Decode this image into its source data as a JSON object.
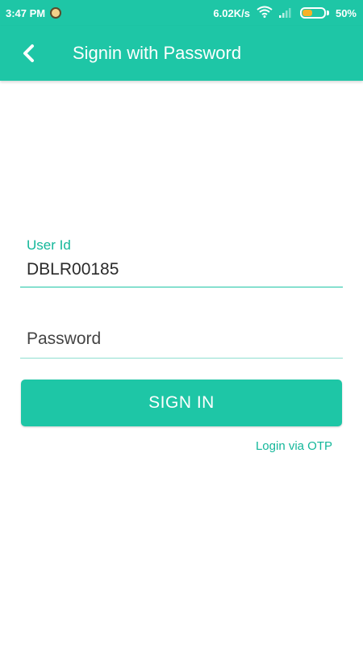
{
  "status_bar": {
    "time": "3:47 PM",
    "network_speed": "6.02K/s",
    "battery_percent": "50%",
    "battery_level": 0.5,
    "icons": [
      "notification-avatar-icon",
      "wifi-icon",
      "signal-icon",
      "battery-icon"
    ]
  },
  "app_bar": {
    "title": "Signin with Password",
    "back_icon": "chevron-left-icon",
    "color": "#1ec6a6"
  },
  "form": {
    "user_id": {
      "label": "User Id",
      "value": "DBLR00185"
    },
    "password": {
      "placeholder": "Password",
      "value": ""
    },
    "signin_label": "SIGN IN",
    "otp_link": "Login via OTP"
  },
  "colors": {
    "accent": "#1ec6a6",
    "accent_text": "#13b79a"
  }
}
